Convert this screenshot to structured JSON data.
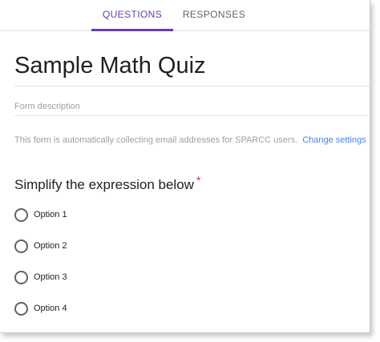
{
  "tabs": {
    "questions": "QUESTIONS",
    "responses": "RESPONSES",
    "active": "questions"
  },
  "form": {
    "title": "Sample Math Quiz",
    "description_placeholder": "Form description",
    "email_notice": "This form is automatically collecting email addresses for SPARCC users.",
    "change_settings": "Change settings"
  },
  "question": {
    "text": "Simplify the expression below",
    "required_mark": "*",
    "options": [
      "Option 1",
      "Option 2",
      "Option 3",
      "Option 4"
    ]
  },
  "colors": {
    "accent": "#673ab7",
    "link": "#4285f4",
    "required": "#d93025"
  }
}
